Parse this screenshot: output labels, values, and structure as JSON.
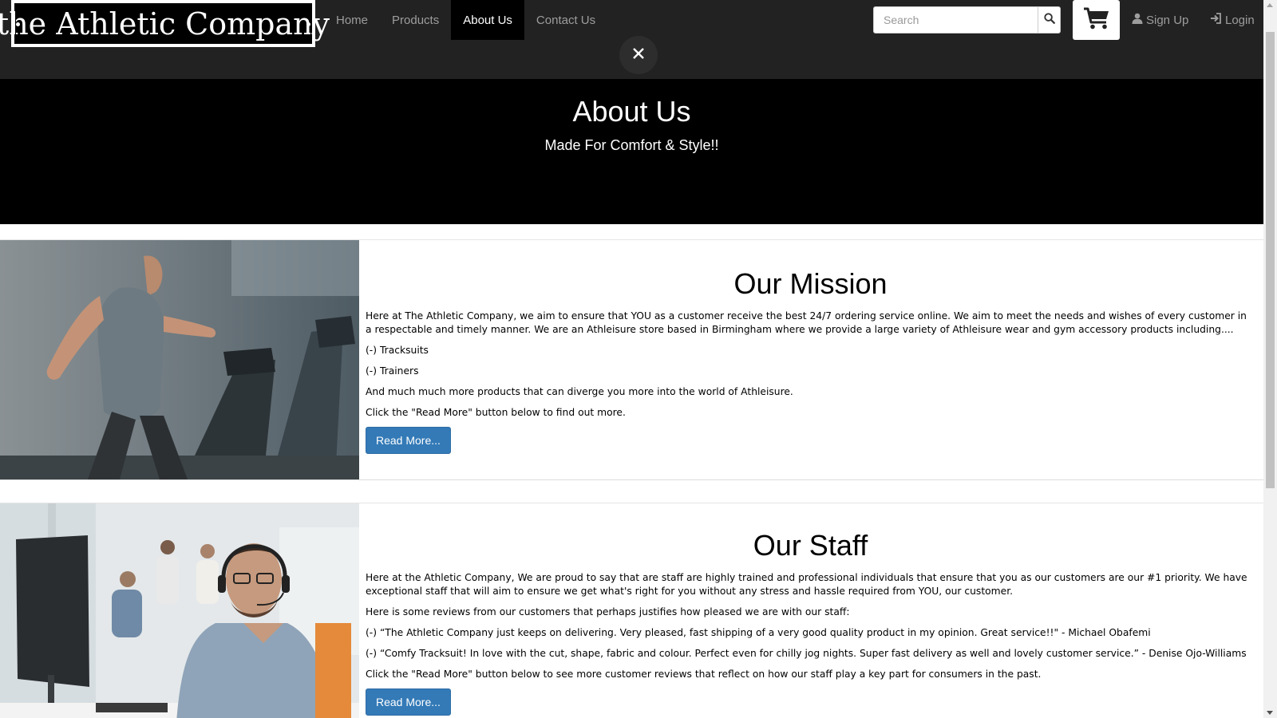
{
  "brand": {
    "logo_text": "the Athletic Company"
  },
  "nav": {
    "links": [
      {
        "label": "Home"
      },
      {
        "label": "Products"
      },
      {
        "label": "About Us",
        "active": true
      },
      {
        "label": "Contact Us"
      }
    ],
    "search": {
      "placeholder": "Search",
      "value": ""
    },
    "signup_label": "Sign Up",
    "login_label": "Login",
    "icons": {
      "search": "search-icon",
      "cart": "cart-icon",
      "signup": "user-icon",
      "login": "login-icon",
      "close": "close-icon"
    }
  },
  "hero": {
    "title": "About Us",
    "subtitle": "Made For Comfort & Style!!"
  },
  "mission": {
    "title": "Our Mission",
    "paragraphs": [
      "Here at The Athletic Company, we aim to ensure that YOU as a customer receive the best 24/7 ordering service online. We aim to meet the needs and wishes of every customer in a respectable and timely manner. We are an Athleisure store based in Birmingham where we provide a large variety of Athleisure wear and gym accessory products including....",
      "(-) Tracksuits",
      "(-) Trainers",
      "And much much more products that can diverge you more into the world of Athleisure.",
      "Click the \"Read More\" button below to find out more."
    ],
    "button_label": "Read More..."
  },
  "staff": {
    "title": "Our Staff",
    "paragraphs": [
      "Here at the Athletic Company, We are proud to say that are staff are highly trained and professional individuals that ensure that you as our customers are our #1 priority. We have exceptional staff that will aim to ensure we get what's right for you without any stress and hassle required from YOU, our customer.",
      "Here is some reviews from our customers that perhaps justifies how pleased we are with our staff:",
      "(-) “The Athletic Company just keeps on delivering. Very pleased, fast shipping of a very good quality product in my opinion. Great service!!\" - Michael Obafemi",
      "(-) “Comfy Tracksuit! In love with the cut, shape, fabric and colour. Perfect even for chilly jog nights. Super fast delivery as well and lovely customer service.” - Denise Ojo-Williams",
      "Click the \"Read More\" button below to see more customer reviews that reflect on how our staff play a key part for consumers in the past."
    ],
    "button_label": "Read More..."
  },
  "colors": {
    "navbar": "#222222",
    "hero": "#000000",
    "button": "#337ab7",
    "nav_text": "#9d9d9d"
  }
}
